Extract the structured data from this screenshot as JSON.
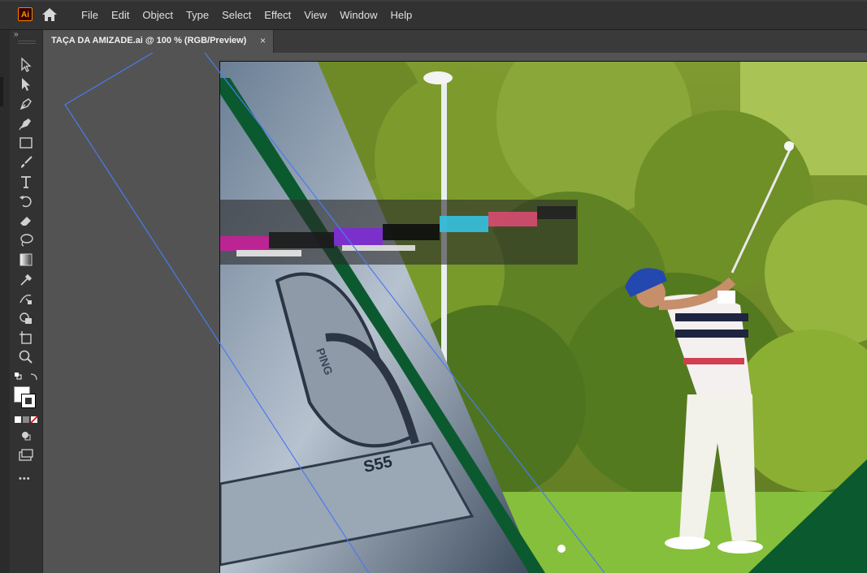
{
  "app": {
    "logo_text": "Ai",
    "home_icon": "home-icon"
  },
  "menu": [
    "File",
    "Edit",
    "Object",
    "Type",
    "Select",
    "Effect",
    "View",
    "Window",
    "Help"
  ],
  "document_tab": {
    "title": "TAÇA DA AMIZADE.ai @ 100 % (RGB/Preview)",
    "close_label": "×"
  },
  "toolbar": {
    "collapse_label": "»",
    "tools": [
      "selection-tool",
      "direct-selection-tool",
      "pen-tool",
      "curvature-tool",
      "rectangle-tool",
      "paintbrush-tool",
      "type-tool",
      "rotate-tool",
      "eraser-tool",
      "lasso-tool",
      "gradient-tool",
      "eyedropper-tool",
      "blend-tool",
      "shape-builder-tool",
      "artboard-tool",
      "zoom-tool"
    ],
    "more_label": "•••"
  },
  "artwork": {
    "colors": {
      "sky_green": "#8aa33c",
      "dark_green": "#0b5a2f",
      "grass": "#7fb83a"
    },
    "club_text": "S55",
    "club_brand": "PING"
  }
}
